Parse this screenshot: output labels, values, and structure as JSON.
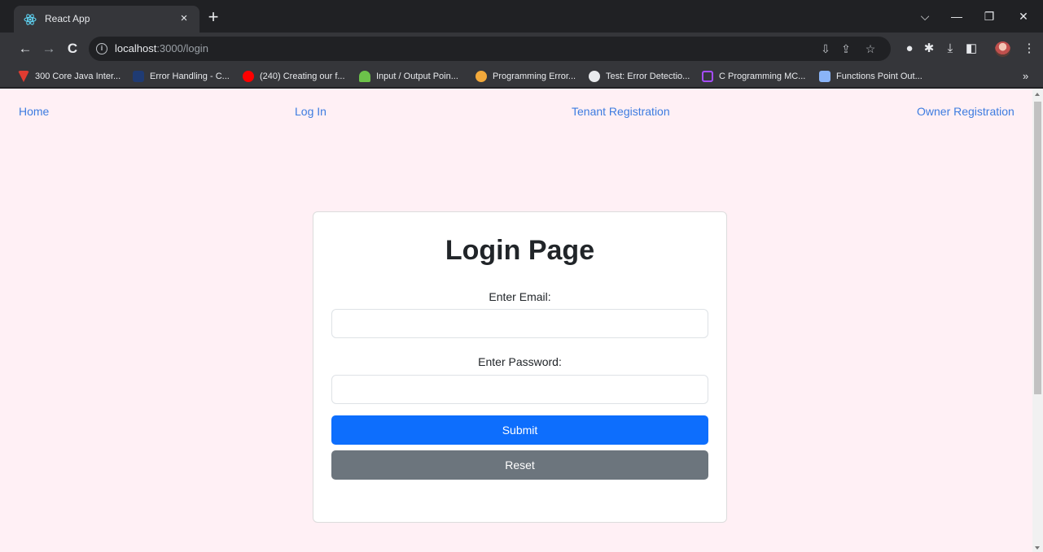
{
  "browser": {
    "tab": {
      "title": "React App",
      "close": "×"
    },
    "new_tab": "+",
    "window_controls": {
      "dropdown": "⌵",
      "minimize": "—",
      "restore": "❐",
      "close": "✕"
    },
    "nav": {
      "back": "←",
      "forward": "→",
      "reload": "C"
    },
    "url": {
      "host": "localhost",
      "path": ":3000/login"
    },
    "bookmarks": [
      {
        "label": "300 Core Java Inter...",
        "color": "#e03c31"
      },
      {
        "label": "Error Handling - C...",
        "color": "#1f3b73"
      },
      {
        "label": "(240) Creating our f...",
        "color": "#ff0000"
      },
      {
        "label": "Input / Output Poin...",
        "color": "#6cc24a"
      },
      {
        "label": "Programming Error...",
        "color": "#f2a93b"
      },
      {
        "label": "Test: Error Detectio...",
        "color": "#e8eaed"
      },
      {
        "label": "C Programming MC...",
        "color": "#a64dff"
      },
      {
        "label": "Functions Point Out...",
        "color": "#8ab4f8"
      }
    ],
    "bookmarks_more": "»"
  },
  "nav": {
    "home": "Home",
    "login": "Log In",
    "tenant": "Tenant Registration",
    "owner": "Owner Registration"
  },
  "login": {
    "title": "Login Page",
    "email_label": "Enter Email:",
    "email_value": "",
    "password_label": "Enter Password:",
    "password_value": "",
    "submit": "Submit",
    "reset": "Reset"
  },
  "colors": {
    "page_bg": "#fff0f5",
    "link": "#3d7ce0",
    "submit": "#0d6efd",
    "reset": "#6c757d"
  }
}
